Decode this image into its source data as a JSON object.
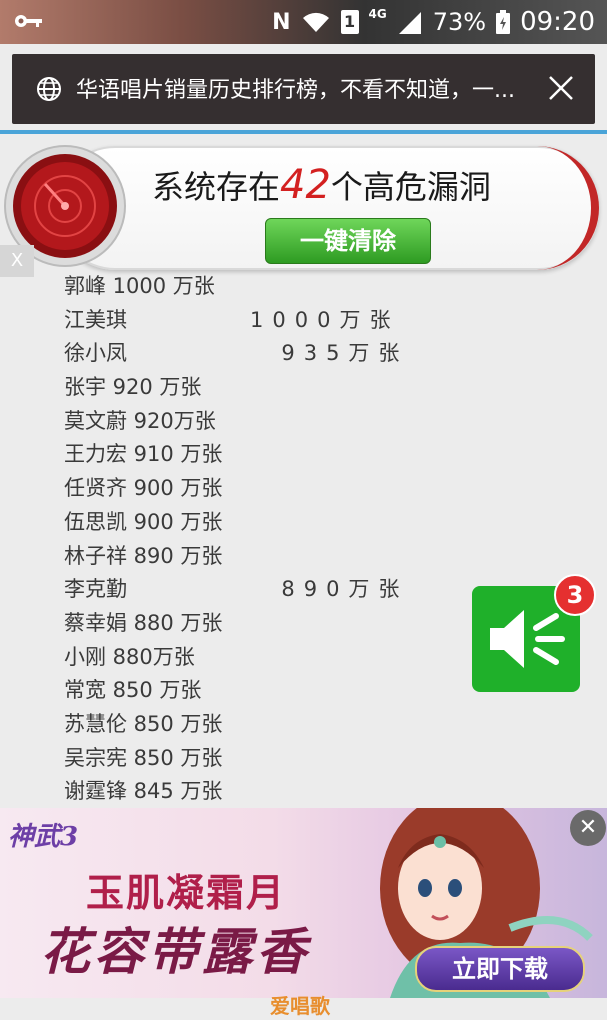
{
  "status_bar": {
    "network_letter": "N",
    "sim": "1",
    "signal_type": "4G",
    "battery": "73%",
    "time": "09:20",
    "icons": [
      "key-icon",
      "wifi-icon",
      "signal-icon",
      "battery-icon"
    ]
  },
  "notification": {
    "text": "华语唱片销量历史排行榜，不看不知道，一...",
    "icons": [
      "globe-icon",
      "close-icon"
    ]
  },
  "scan_ad": {
    "title_prefix": "系统存在",
    "title_number": "42",
    "title_suffix": "个高危漏洞",
    "button_label": "一键清除",
    "close_label": "X"
  },
  "ranking": [
    {
      "name": "郭峰 1000 万张",
      "value": ""
    },
    {
      "name": "江美琪",
      "value": "1000万张"
    },
    {
      "name": "徐小凤",
      "value": "  935万张"
    },
    {
      "name": "张宇 920 万张",
      "value": ""
    },
    {
      "name": "莫文蔚 920万张",
      "value": ""
    },
    {
      "name": "王力宏 910 万张",
      "value": ""
    },
    {
      "name": "任贤齐 900 万张",
      "value": ""
    },
    {
      "name": "伍思凯 900 万张",
      "value": ""
    },
    {
      "name": "林子祥 890 万张",
      "value": ""
    },
    {
      "name": "李克勤",
      "value": "  890万张"
    },
    {
      "name": "蔡幸娟 880 万张",
      "value": ""
    },
    {
      "name": "小刚 880万张",
      "value": ""
    },
    {
      "name": "常宽 850 万张",
      "value": ""
    },
    {
      "name": "苏慧伦 850 万张",
      "value": ""
    },
    {
      "name": "吴宗宪 850 万张",
      "value": ""
    },
    {
      "name": "谢霆锋 845 万张",
      "value": ""
    }
  ],
  "sound_button": {
    "badge": "3",
    "icon": "speaker-icon"
  },
  "game_ad": {
    "logo": "神武3",
    "line1": "玉肌凝霜月",
    "line2": "花容带露香",
    "button_label": "立即下载",
    "close_label": "✕"
  },
  "watermark": "爱唱歌"
}
